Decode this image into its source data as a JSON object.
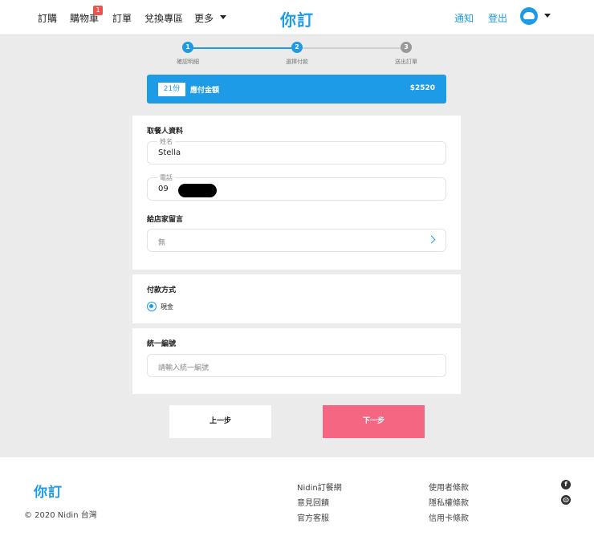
{
  "header": {
    "nav": [
      "訂購",
      "購物車",
      "訂單",
      "兌換專區",
      "更多"
    ],
    "cart_badge": "1",
    "logo": "你訂",
    "notify": "通知",
    "logout": "登出"
  },
  "steps": [
    {
      "num": "1",
      "label": "確認明細",
      "color": "#1e9be6"
    },
    {
      "num": "2",
      "label": "選擇付款",
      "color": "#1e9be6"
    },
    {
      "num": "3",
      "label": "送出訂單",
      "color": "#9a9a9a"
    }
  ],
  "summary": {
    "quantity": "21份",
    "label": "應付金額",
    "total": "$2520"
  },
  "recipient": {
    "title": "取餐人資料",
    "name_label": "姓名",
    "name_value": "Stella",
    "phone_label": "電話",
    "phone_value": "09",
    "note_title": "給店家留言",
    "note_value": "無"
  },
  "payment": {
    "title": "付款方式",
    "option": "現金"
  },
  "tax": {
    "title": "統一編號",
    "placeholder": "請輸入統一編號"
  },
  "buttons": {
    "prev": "上一步",
    "next": "下一步"
  },
  "footer": {
    "logo": "你訂",
    "copyright": "© 2020 Nidin 台灣",
    "col1": [
      "Nidin訂餐網",
      "意見回饋",
      "官方客服"
    ],
    "col2": [
      "使用者條款",
      "隱私權條款",
      "信用卡條款"
    ],
    "icons": [
      "facebook-icon",
      "line-icon"
    ]
  },
  "colors": {
    "accent": "#1e9be6",
    "next_button": "#f46682",
    "badge": "#e8544e"
  }
}
